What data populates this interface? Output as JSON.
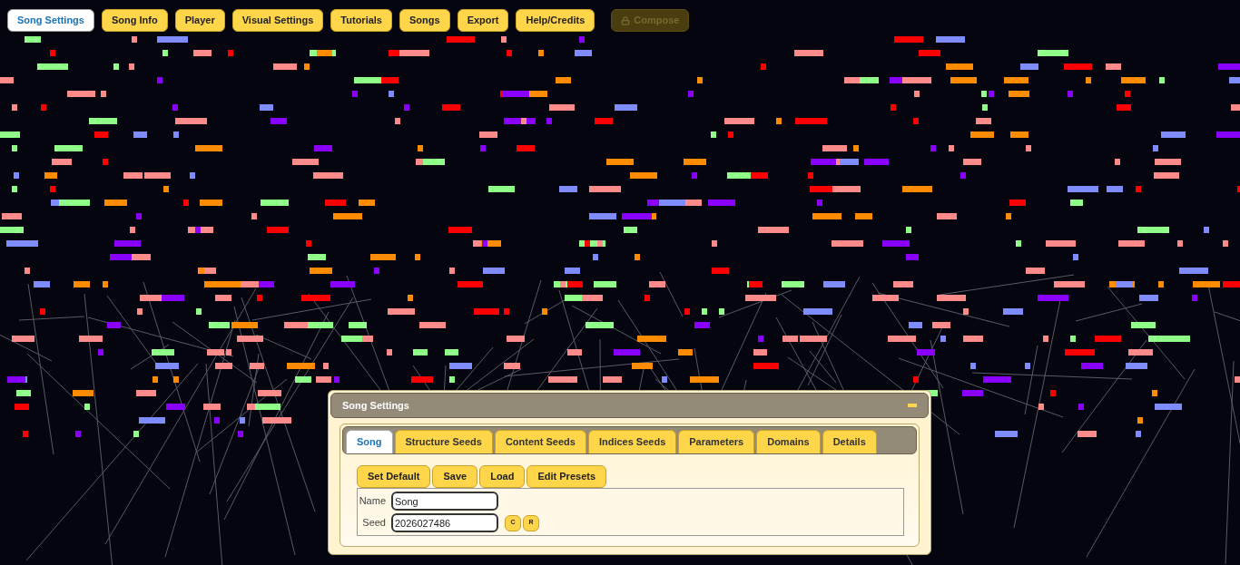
{
  "nav": [
    {
      "label": "Song Settings",
      "selected": true,
      "disabled": false
    },
    {
      "label": "Song Info",
      "selected": false,
      "disabled": false
    },
    {
      "label": "Player",
      "selected": false,
      "disabled": false
    },
    {
      "label": "Visual Settings",
      "selected": false,
      "disabled": false
    },
    {
      "label": "Tutorials",
      "selected": false,
      "disabled": false
    },
    {
      "label": "Songs",
      "selected": false,
      "disabled": false
    },
    {
      "label": "Export",
      "selected": false,
      "disabled": false
    },
    {
      "label": "Help/Credits",
      "selected": false,
      "disabled": false
    },
    {
      "label": "Compose",
      "selected": false,
      "disabled": true
    }
  ],
  "dialog": {
    "title": "Song Settings",
    "tabs": [
      {
        "label": "Song",
        "selected": true
      },
      {
        "label": "Structure Seeds",
        "selected": false
      },
      {
        "label": "Content Seeds",
        "selected": false
      },
      {
        "label": "Indices Seeds",
        "selected": false
      },
      {
        "label": "Parameters",
        "selected": false
      },
      {
        "label": "Domains",
        "selected": false
      },
      {
        "label": "Details",
        "selected": false
      }
    ],
    "actions": [
      "Set Default",
      "Save",
      "Load",
      "Edit Presets"
    ],
    "fields": [
      {
        "label": "Name",
        "value": "Song"
      },
      {
        "label": "Seed",
        "value": "2026027486",
        "buttons": [
          "C",
          "R"
        ]
      }
    ]
  }
}
